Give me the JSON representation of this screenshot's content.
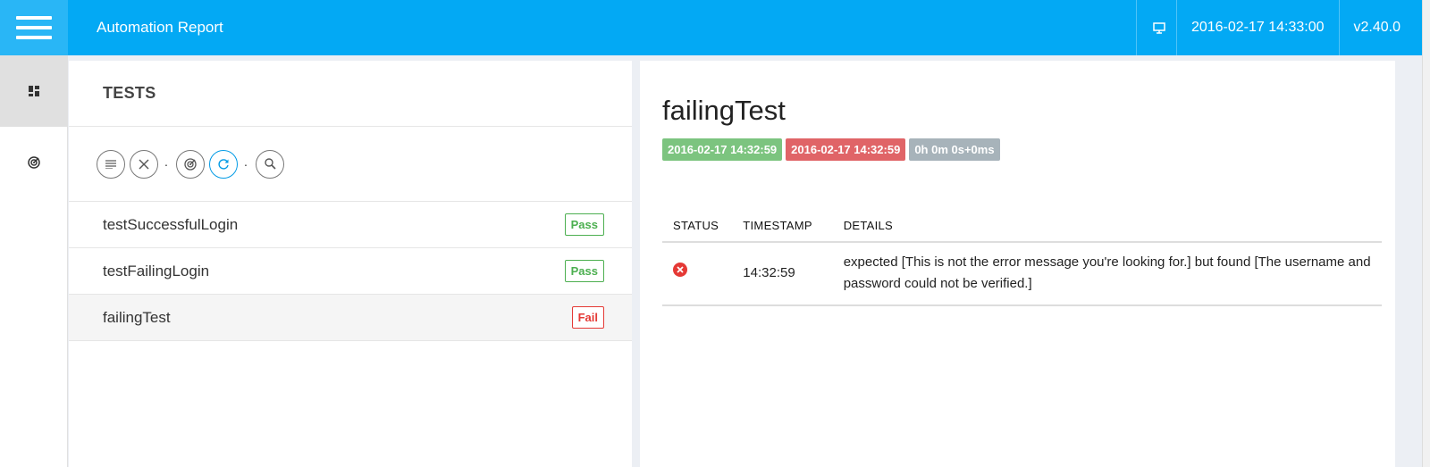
{
  "header": {
    "title": "Automation Report",
    "datetime": "2016-02-17 14:33:00",
    "version": "v2.40.0"
  },
  "sidenav": {
    "items": [
      {
        "icon": "dashboard-icon",
        "active": true
      },
      {
        "icon": "radar-icon",
        "active": false
      }
    ]
  },
  "tests_panel": {
    "title": "TESTS",
    "toolbar": [
      "list-icon",
      "close-icon",
      "radar-icon",
      "refresh-icon",
      "search-icon"
    ],
    "tests": [
      {
        "name": "testSuccessfulLogin",
        "status": "Pass"
      },
      {
        "name": "testFailingLogin",
        "status": "Pass"
      },
      {
        "name": "failingTest",
        "status": "Fail"
      }
    ]
  },
  "detail": {
    "title": "failingTest",
    "start_time": "2016-02-17 14:32:59",
    "end_time": "2016-02-17 14:32:59",
    "duration": "0h 0m 0s+0ms",
    "columns": [
      "STATUS",
      "TIMESTAMP",
      "DETAILS"
    ],
    "logs": [
      {
        "status_icon": "error-icon",
        "timestamp": "14:32:59",
        "details": "expected [This is not the error message you're looking for.] but found [The username and password could not be verified.]"
      }
    ]
  },
  "colors": {
    "primary": "#03a9f4",
    "pass": "#4caf50",
    "fail": "#e53935"
  }
}
